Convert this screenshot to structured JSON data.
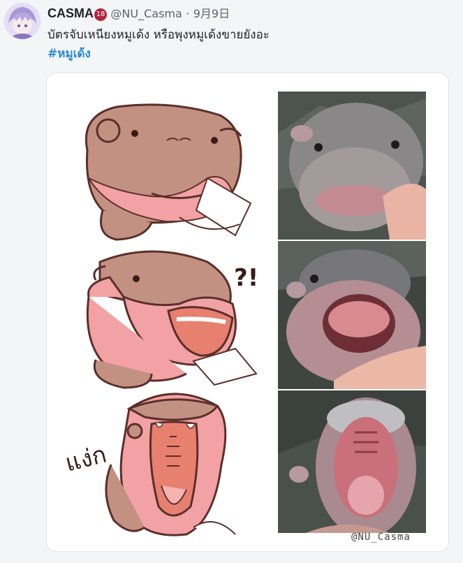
{
  "post": {
    "display_name": "CASMA",
    "age_badge": "18",
    "handle": "@NU_Casma",
    "separator": "·",
    "date": "9月9日",
    "text": "บัตรจับเหนียงหมูเด้ง หรือพุงหมูเด้งขายยังอะ",
    "hashtag": "#หมูเด้ง"
  },
  "image": {
    "panel_2_caption": "?!",
    "panel_3_caption": "แง่ก",
    "watermark": "@NU_Casma"
  },
  "colors": {
    "hippo_body": "#c39182",
    "hippo_pink": "#f2a2a4",
    "outline": "#5a2f2a",
    "link": "#2b8ad6"
  }
}
